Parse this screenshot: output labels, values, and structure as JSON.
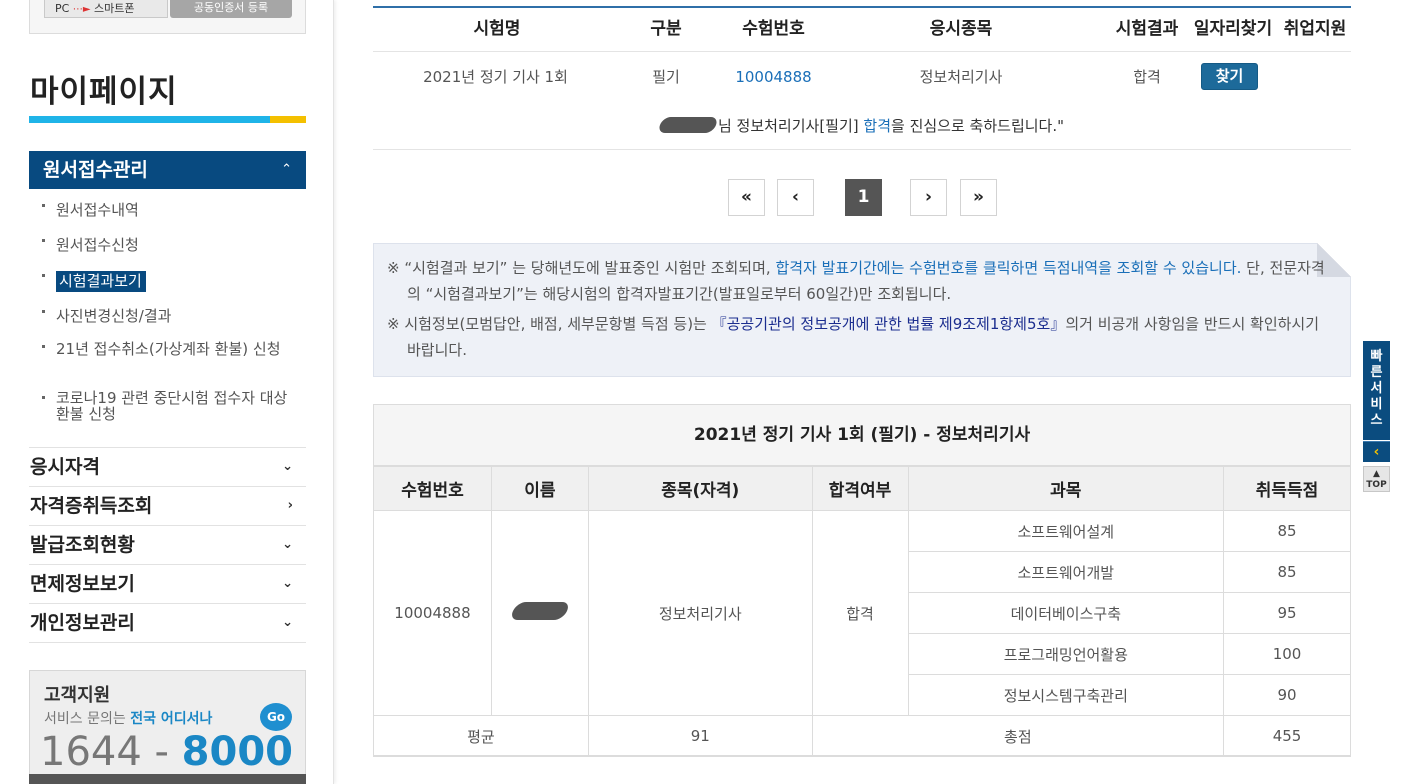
{
  "sidebar": {
    "pc_label": "PC",
    "mobile_label": "스마트폰",
    "gray_button_label": "공동인증서 등록",
    "title": "마이페이지",
    "active_menu": "원서접수관리",
    "submenu": [
      "원서접수내역",
      "원서접수신청",
      "시험결과보기",
      "사진변경신청/결과",
      "21년 접수취소(가상계좌 환불) 신청",
      "코로나19 관련 중단시험 접수자 대상 환불 신청"
    ],
    "menus": [
      "응시자격",
      "자격증취득조회",
      "발급조회현황",
      "면제정보보기",
      "개인정보관리"
    ],
    "support": {
      "title": "고객지원",
      "desc_prefix": "서비스 문의는 ",
      "desc_highlight": "전국 어디서나",
      "phone_prefix": "1644 - ",
      "phone_highlight": "8000",
      "go_label": "Go"
    }
  },
  "exam_table": {
    "headers": [
      "시험명",
      "구분",
      "수험번호",
      "응시종목",
      "시험결과",
      "일자리찾기",
      "취업지원"
    ],
    "row": {
      "exam_name": "2021년 정기 기사 1회",
      "type": "필기",
      "exam_no": "10004888",
      "subject": "정보처리기사",
      "result": "합격",
      "find_button": "찾기"
    },
    "congrats_part1": "님 정보처리기사[필기] ",
    "congrats_highlight": "합격",
    "congrats_part2": "을 진심으로 축하드립니다.\""
  },
  "pagination": {
    "first": "«",
    "prev": "‹",
    "current": "1",
    "next": "›",
    "last": "»"
  },
  "notice": {
    "line1_prefix": "※ “시험결과 보기” 는 당해년도에 발표중인 시험만 조회되며, ",
    "line1_highlight": "합격자 발표기간에는 수험번호를 클릭하면 득점내역을 조회할 수 있습니다.",
    "line1_suffix": " 단, 전문자격의 “시험결과보기”는 해당시험의 합격자발표기간(발표일로부터 60일간)만 조회됩니다.",
    "line2_prefix": "※ 시험정보(모범답안, 배점, 세부문항별 득점 등)는 ",
    "line2_highlight": "『공공기관의 정보공개에 관한 법률 제9조제1항제5호』",
    "line2_suffix": "의거 비공개 사항임을 반드시 확인하시기 바랍니다."
  },
  "result": {
    "caption": "2021년 정기 기사 1회 (필기) - 정보처리기사",
    "headers": [
      "수험번호",
      "이름",
      "종목(자격)",
      "합격여부",
      "과목",
      "취득득점"
    ],
    "exam_no": "10004888",
    "qualification": "정보처리기사",
    "pass": "합격",
    "subjects": [
      {
        "name": "소프트웨어설계",
        "score": "85"
      },
      {
        "name": "소프트웨어개발",
        "score": "85"
      },
      {
        "name": "데이터베이스구축",
        "score": "95"
      },
      {
        "name": "프로그래밍언어활용",
        "score": "100"
      },
      {
        "name": "정보시스템구축관리",
        "score": "90"
      }
    ],
    "avg_label": "평균",
    "avg_value": "91",
    "total_label": "총점",
    "total_value": "455"
  },
  "widget": {
    "quick_service": "빠른서비스",
    "top_label": "TOP"
  },
  "colors": {
    "accent_navy": "#084a80",
    "accent_blue": "#1fb4e8",
    "accent_yellow": "#f4c000",
    "link_blue": "#1a6fb8"
  }
}
